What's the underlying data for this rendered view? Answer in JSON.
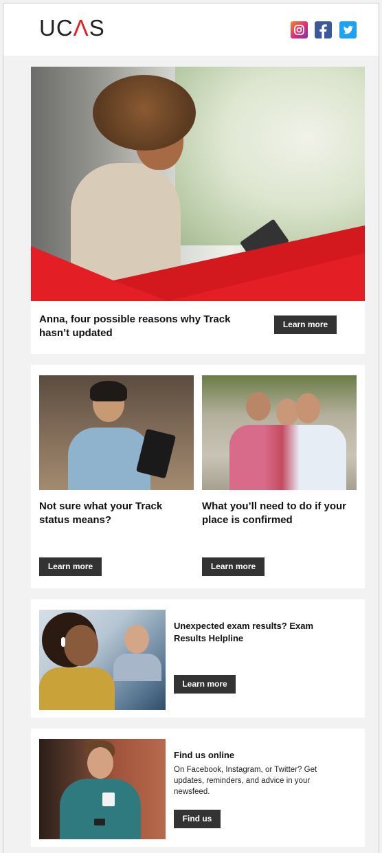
{
  "header": {
    "logo_pre": "UC",
    "logo_a": "Λ",
    "logo_post": "S",
    "social": [
      "instagram-icon",
      "facebook-icon",
      "twitter-icon"
    ]
  },
  "hero": {
    "title": "Anna, four possible reasons why Track hasn’t updated",
    "button": "Learn more"
  },
  "cards": [
    {
      "title": "Not sure what your Track status means?",
      "button": "Learn more"
    },
    {
      "title": "What you’ll need to do if your place is confirmed",
      "button": "Learn more"
    }
  ],
  "helpline": {
    "title": "Unexpected exam results? Exam Results Helpline",
    "button": "Learn more"
  },
  "online": {
    "title": "Find us online",
    "description": "On Facebook, Instagram, or Twitter? Get updates, reminders, and advice in your newsfeed.",
    "button": "Find us"
  },
  "colors": {
    "brand_red": "#e31e24",
    "button_bg": "#333333",
    "page_bg": "#f2f2f2"
  }
}
